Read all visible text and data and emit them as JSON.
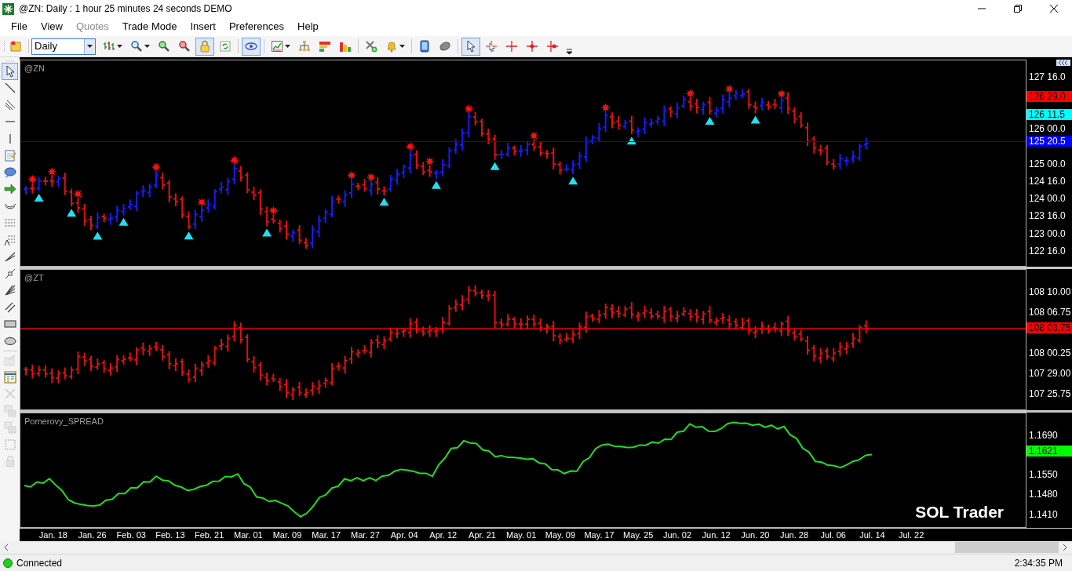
{
  "window": {
    "title": "@ZN: Daily : 1 hour 25 minutes 24 seconds DEMO"
  },
  "menu": [
    {
      "label": "File",
      "disabled": false
    },
    {
      "label": "View",
      "disabled": false
    },
    {
      "label": "Quotes",
      "disabled": true
    },
    {
      "label": "Trade Mode",
      "disabled": false
    },
    {
      "label": "Insert",
      "disabled": false
    },
    {
      "label": "Preferences",
      "disabled": false
    },
    {
      "label": "Help",
      "disabled": false
    }
  ],
  "toolbar": {
    "interval": "Daily",
    "tools": [
      {
        "kind": "note",
        "selected": false,
        "dropdown": false
      },
      {
        "kind": "bars",
        "selected": false,
        "dropdown": true
      },
      {
        "kind": "search",
        "selected": false,
        "dropdown": true
      },
      {
        "kind": "zoom-in",
        "selected": false,
        "dropdown": false
      },
      {
        "kind": "zoom-out",
        "selected": false,
        "dropdown": false
      },
      {
        "kind": "lock",
        "selected": true,
        "dropdown": false
      },
      {
        "kind": "refresh",
        "selected": false,
        "dropdown": false
      },
      {
        "kind": "eye",
        "selected": true,
        "dropdown": false
      },
      {
        "kind": "line-chart",
        "selected": false,
        "dropdown": true
      },
      {
        "kind": "hierarchy",
        "selected": false,
        "dropdown": false
      },
      {
        "kind": "color-bars",
        "selected": false,
        "dropdown": false
      },
      {
        "kind": "bar-chart",
        "selected": false,
        "dropdown": false
      },
      {
        "kind": "tools",
        "selected": false,
        "dropdown": false
      },
      {
        "kind": "bell",
        "selected": false,
        "dropdown": true
      },
      {
        "kind": "tablet",
        "selected": false,
        "dropdown": false
      },
      {
        "kind": "mouse",
        "selected": false,
        "dropdown": false
      },
      {
        "kind": "cursor",
        "selected": true,
        "dropdown": false
      },
      {
        "kind": "cursor-crosshair",
        "selected": false,
        "dropdown": false
      },
      {
        "kind": "crosshair",
        "selected": false,
        "dropdown": false
      },
      {
        "kind": "crosshair-dot",
        "selected": false,
        "dropdown": false
      },
      {
        "kind": "crosshair-marker",
        "selected": false,
        "dropdown": false
      }
    ]
  },
  "drawing_tools": [
    {
      "kind": "cursor",
      "selected": true,
      "disabled": false
    },
    {
      "kind": "trend-line",
      "selected": false,
      "disabled": false
    },
    {
      "kind": "parallel-lines",
      "selected": false,
      "disabled": false
    },
    {
      "kind": "horizontal-line",
      "selected": false,
      "disabled": false
    },
    {
      "kind": "vertical-line",
      "selected": false,
      "disabled": false
    },
    {
      "kind": "notepad",
      "selected": false,
      "disabled": false
    },
    {
      "kind": "speech-bubble",
      "selected": false,
      "disabled": false
    },
    {
      "kind": "arrow",
      "selected": false,
      "disabled": false
    },
    {
      "kind": "arc",
      "selected": false,
      "disabled": false
    },
    {
      "kind": "dotted-lines",
      "selected": false,
      "disabled": false
    },
    {
      "kind": "fibonacci",
      "selected": false,
      "disabled": false
    },
    {
      "kind": "pencil-lines",
      "selected": false,
      "disabled": false
    },
    {
      "kind": "node-line",
      "selected": false,
      "disabled": false
    },
    {
      "kind": "fan-lines",
      "selected": false,
      "disabled": false
    },
    {
      "kind": "double-slash",
      "selected": false,
      "disabled": false
    },
    {
      "kind": "rectangle",
      "selected": false,
      "disabled": false
    },
    {
      "kind": "ellipse",
      "selected": false,
      "disabled": false
    },
    {
      "kind": "window",
      "selected": false,
      "disabled": true
    },
    {
      "kind": "table",
      "selected": false,
      "disabled": false
    },
    {
      "kind": "delete",
      "selected": false,
      "disabled": true
    },
    {
      "kind": "layers",
      "selected": false,
      "disabled": true
    },
    {
      "kind": "layers",
      "selected": false,
      "disabled": true
    },
    {
      "kind": "selection",
      "selected": false,
      "disabled": true
    },
    {
      "kind": "lock",
      "selected": false,
      "disabled": true
    }
  ],
  "panes": [
    {
      "title": "@ZN",
      "kind": "bars",
      "axis_labels": [
        "127 16.0",
        "126 00.0",
        "125 00.0",
        "124 16.0",
        "124 00.0",
        "123 16.0",
        "123 00.0",
        "122 16.0"
      ],
      "badges": [
        {
          "text": "126 29.0",
          "color": "#ff0000",
          "line": false
        },
        {
          "text": "126 11.5",
          "color": "#00ffff",
          "line": false
        },
        {
          "text": "125 20.5",
          "color": "#0000ff",
          "line": true
        }
      ]
    },
    {
      "title": "@ZT",
      "kind": "bars",
      "axis_labels": [
        "108 10.00",
        "108 06.75",
        "108 00.25",
        "107 29.00",
        "107 25.75"
      ],
      "badges": [
        {
          "text": "108 03.75",
          "color": "#ff0000",
          "line": true
        }
      ]
    },
    {
      "title": "Pomerovy_SPREAD",
      "kind": "line",
      "axis_labels": [
        "1.1690",
        "1.1550",
        "1.1480",
        "1.1410"
      ],
      "badges": [
        {
          "text": "1.1621",
          "color": "#00ff00",
          "line": false
        }
      ],
      "brand": "SOL Trader"
    }
  ],
  "dates": [
    "Jan. 18",
    "Jan. 26",
    "Feb. 03",
    "Feb. 13",
    "Feb. 21",
    "Mar. 01",
    "Mar. 09",
    "Mar. 17",
    "Mar. 27",
    "Apr. 04",
    "Apr. 12",
    "Apr. 21",
    "May. 01",
    "May. 09",
    "May. 17",
    "May. 25",
    "Jun. 02",
    "Jun. 12",
    "Jun. 20",
    "Jun. 28",
    "Jul. 06",
    "Jul. 14",
    "Jul. 22"
  ],
  "status_bar": {
    "connection": "Connected",
    "connected": true,
    "time": "2:34:35 PM"
  }
}
